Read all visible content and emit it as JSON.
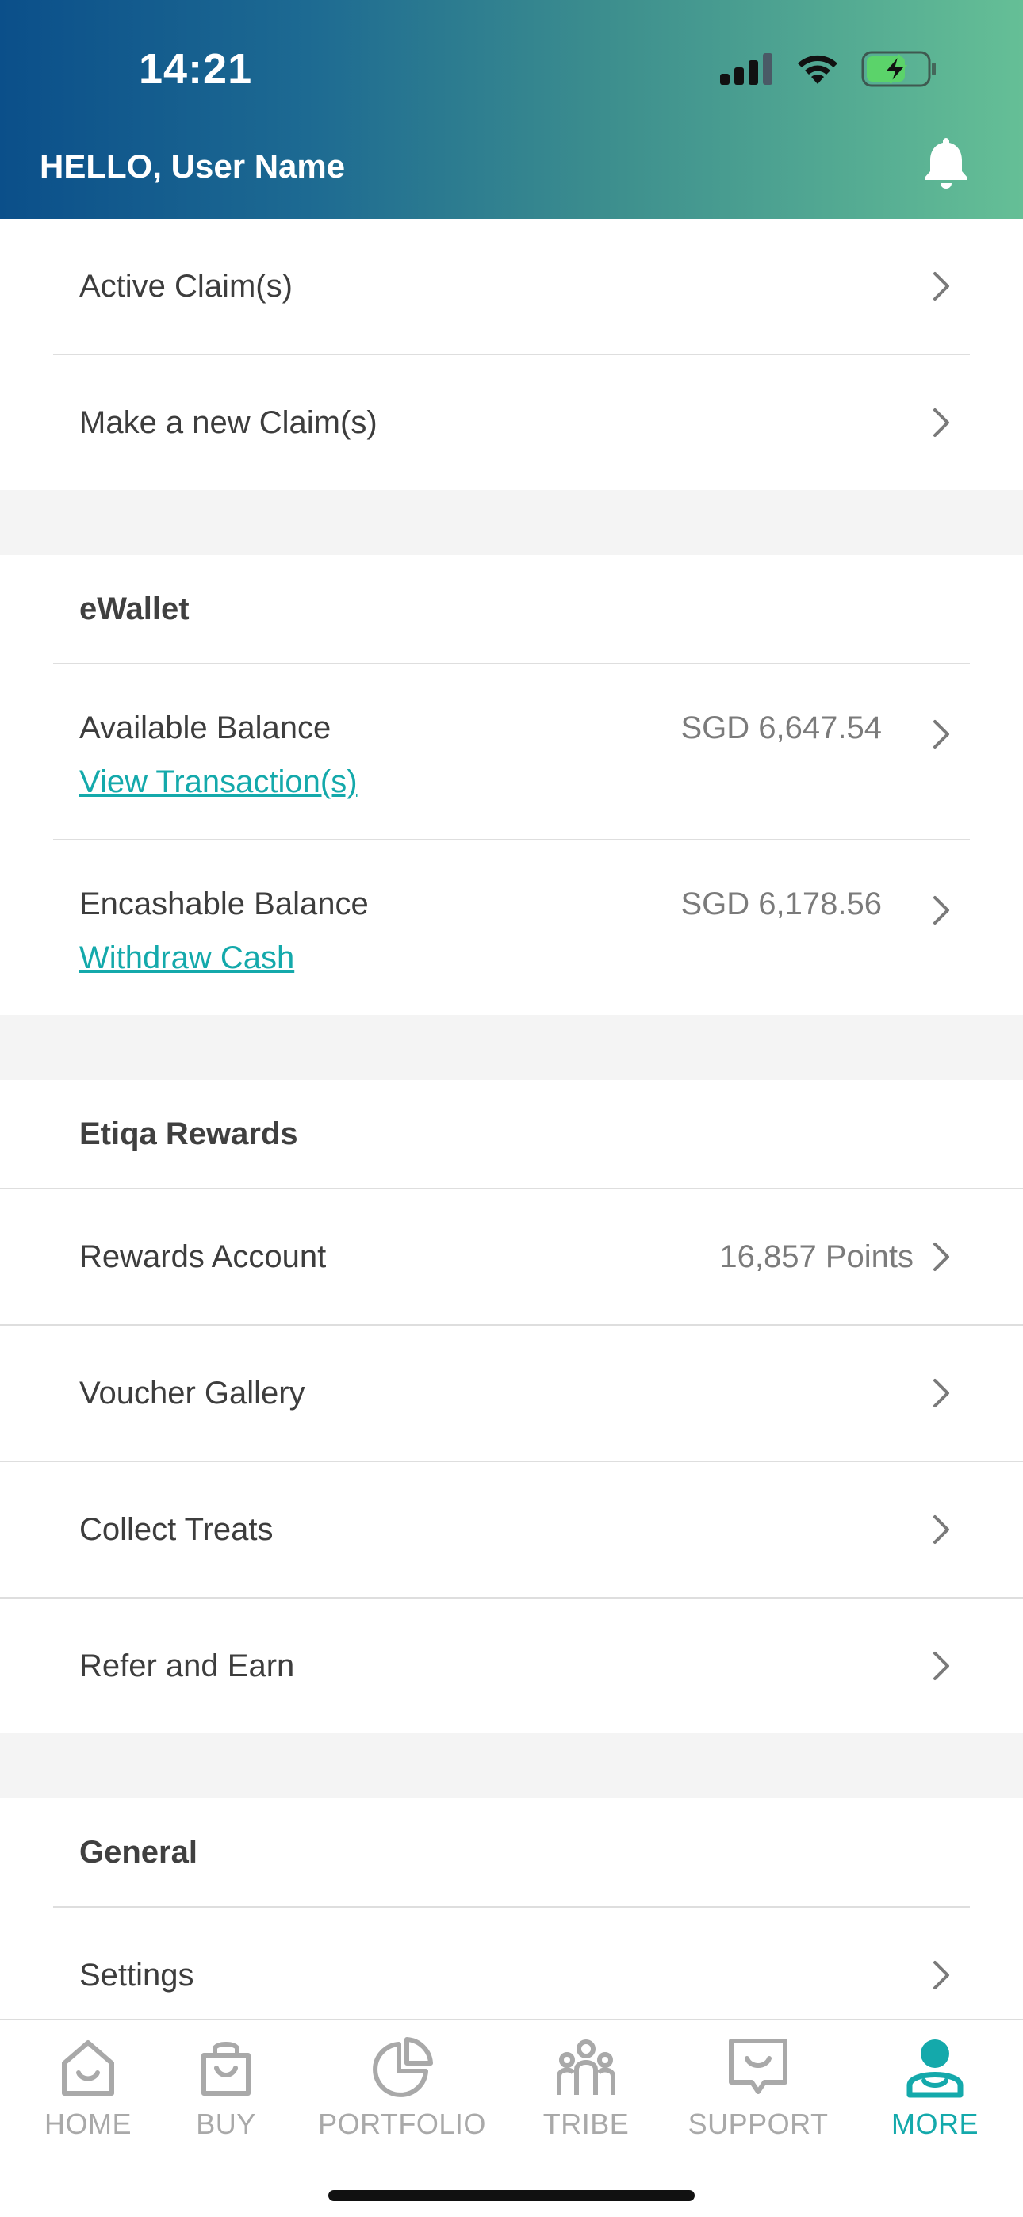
{
  "status_bar": {
    "time": "14:21"
  },
  "header": {
    "greeting": "HELLO, User Name"
  },
  "claims": {
    "active": "Active Claim(s)",
    "new": "Make a new Claim(s)"
  },
  "ewallet": {
    "title": "eWallet",
    "available_label": "Available Balance",
    "available_value": "SGD 6,647.54",
    "available_link": "View Transaction(s)",
    "encashable_label": "Encashable Balance",
    "encashable_value": "SGD 6,178.56",
    "encashable_link": "Withdraw Cash"
  },
  "rewards": {
    "title": "Etiqa Rewards",
    "account_label": "Rewards Account",
    "account_value": "16,857 Points",
    "voucher": "Voucher Gallery",
    "treats": "Collect Treats",
    "refer": "Refer and Earn"
  },
  "general": {
    "title": "General",
    "settings": "Settings"
  },
  "tabs": [
    {
      "label": "HOME",
      "icon": "home-icon"
    },
    {
      "label": "BUY",
      "icon": "shopping-bag-icon"
    },
    {
      "label": "PORTFOLIO",
      "icon": "pie-chart-icon"
    },
    {
      "label": "TRIBE",
      "icon": "people-icon"
    },
    {
      "label": "SUPPORT",
      "icon": "chat-icon"
    },
    {
      "label": "MORE",
      "icon": "user-icon",
      "active": true
    }
  ],
  "colors": {
    "accent": "#14a9ab",
    "header_start": "#0b4f8a",
    "header_end": "#65bf96",
    "inactive_tab": "#a9a9a9"
  }
}
